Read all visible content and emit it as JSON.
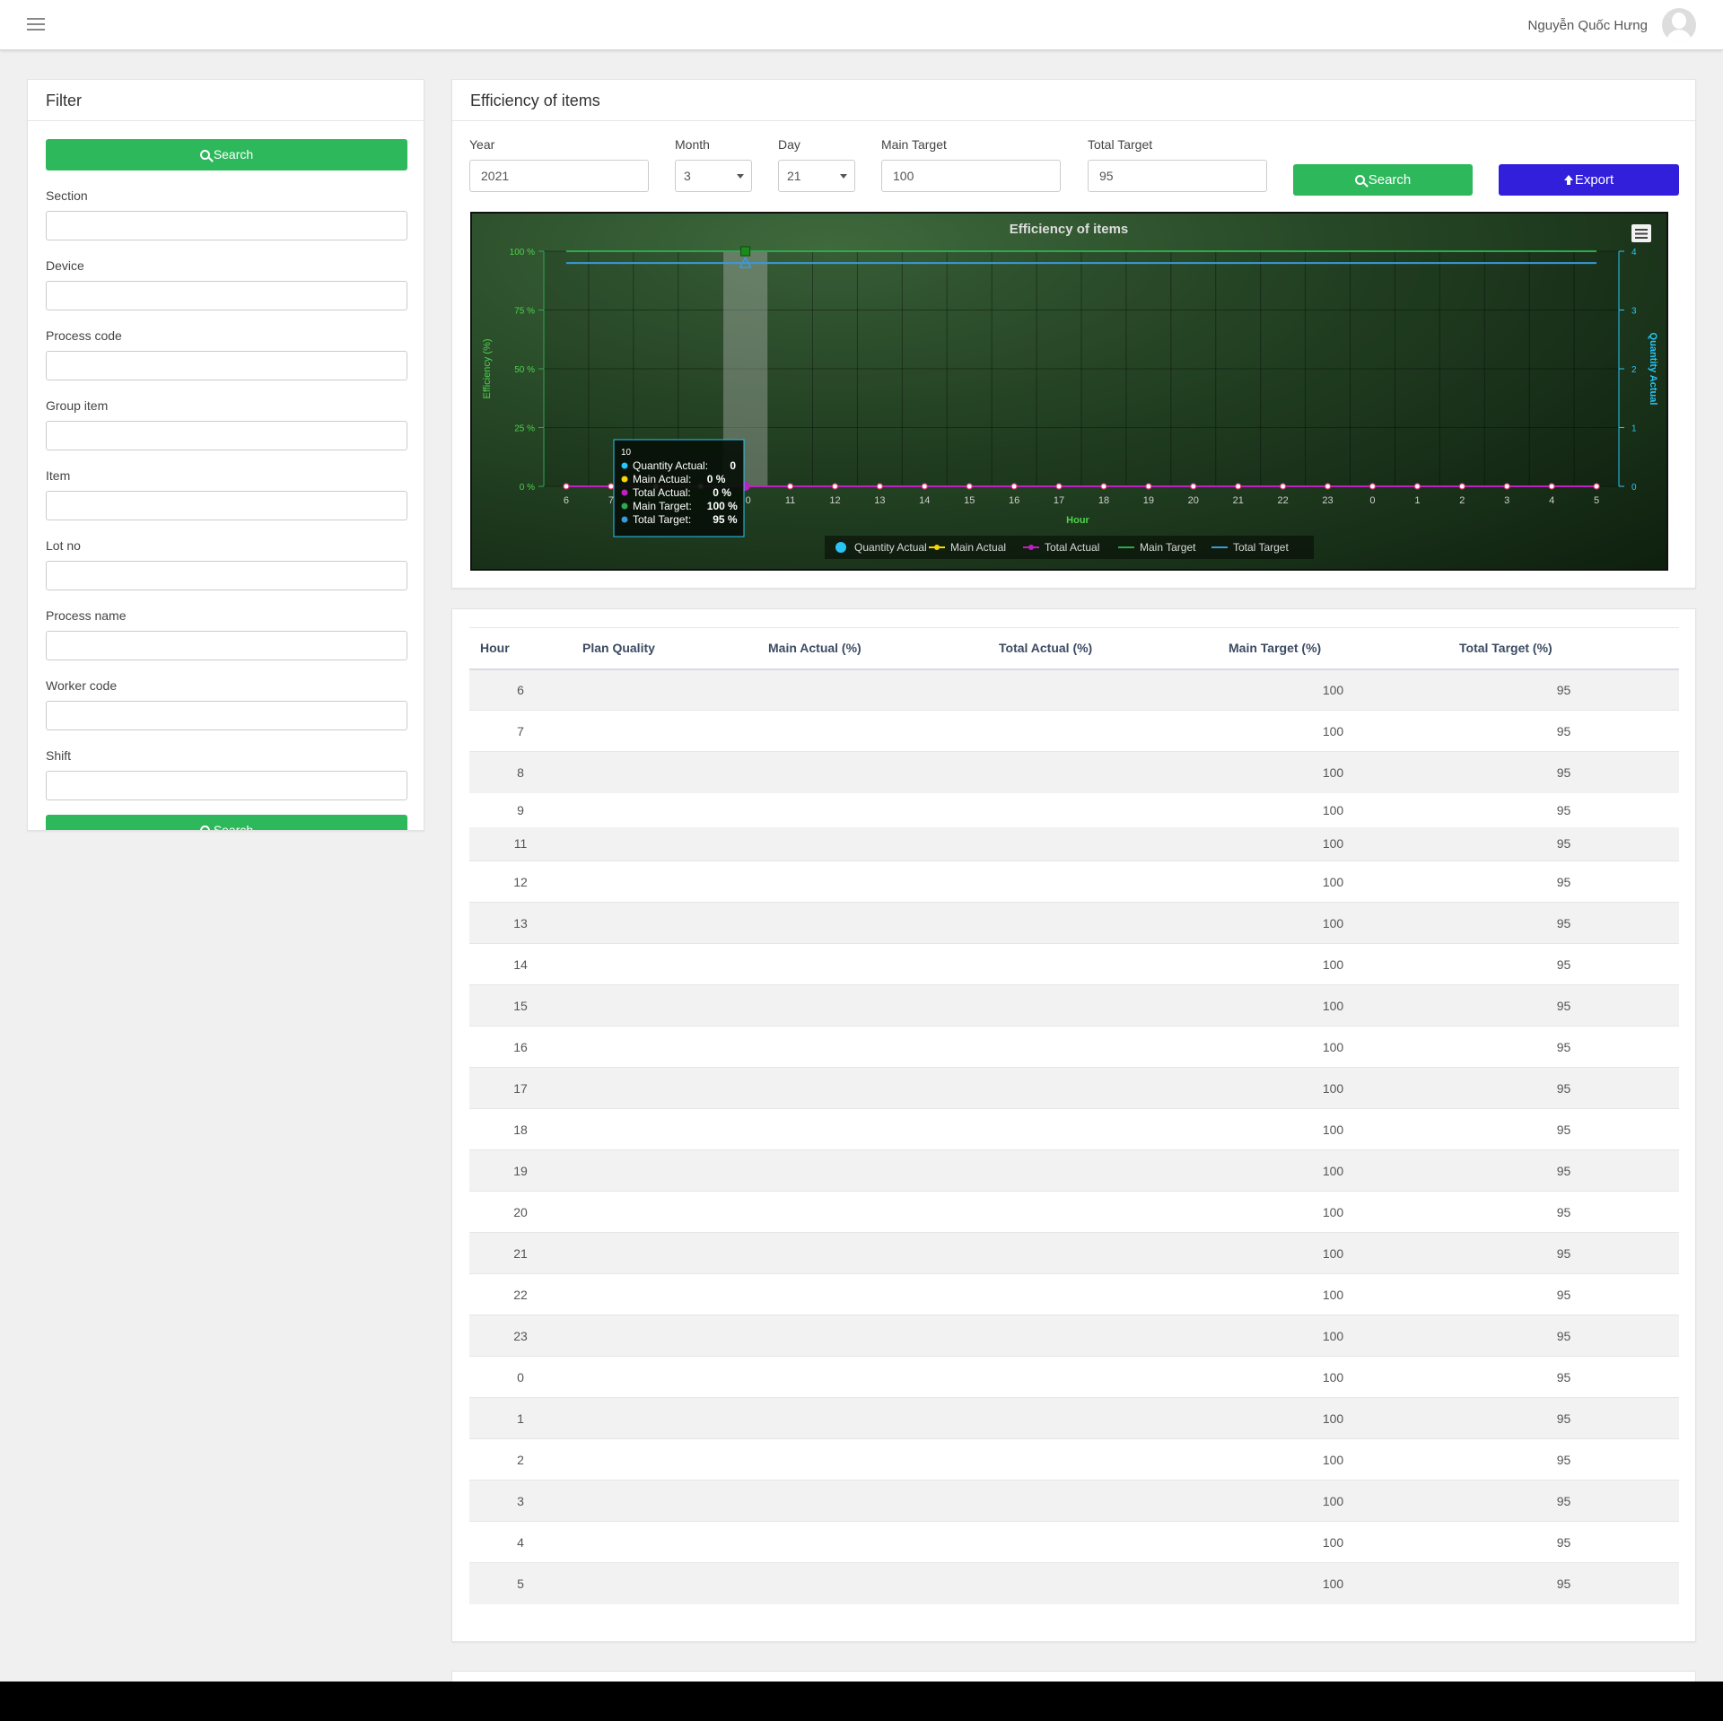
{
  "header": {
    "user_name": "Nguyễn Quốc Hưng"
  },
  "filter": {
    "title": "Filter",
    "search_label": "Search",
    "fields": [
      "Section",
      "Device",
      "Process code",
      "Group item",
      "Item",
      "Lot no",
      "Process name",
      "Worker code",
      "Shift"
    ]
  },
  "main": {
    "title": "Efficiency of items",
    "form": {
      "year_label": "Year",
      "year_value": "2021",
      "month_label": "Month",
      "month_value": "3",
      "day_label": "Day",
      "day_value": "21",
      "main_target_label": "Main Target",
      "main_target_value": "100",
      "total_target_label": "Total Target",
      "total_target_value": "95",
      "search_label": "Search",
      "export_label": "Export"
    }
  },
  "colors": {
    "quantity_actual": "#29c5f6",
    "main_actual": "#f5d800",
    "total_actual": "#c020c0",
    "main_target": "#2fa84f",
    "total_target": "#3b9ad9",
    "green_button": "#2eb85c",
    "export_button": "#321fdb"
  },
  "chart_data": {
    "type": "line",
    "title": "Efficiency of items",
    "xlabel": "Hour",
    "ylabel": "Efficiency (%)",
    "y2label": "Quantity Actual",
    "categories": [
      "6",
      "7",
      "8",
      "9",
      "10",
      "11",
      "12",
      "13",
      "14",
      "15",
      "16",
      "17",
      "18",
      "19",
      "20",
      "21",
      "22",
      "23",
      "0",
      "1",
      "2",
      "3",
      "4",
      "5"
    ],
    "x_tick_labels": [
      "6",
      "7",
      "",
      "",
      "0",
      "11",
      "12",
      "13",
      "14",
      "15",
      "16",
      "17",
      "18",
      "19",
      "20",
      "21",
      "22",
      "23",
      "0",
      "1",
      "2",
      "3",
      "4",
      "5"
    ],
    "ylim": [
      0,
      100
    ],
    "y_ticks": [
      "0 %",
      "25 %",
      "50 %",
      "75 %",
      "100 %"
    ],
    "y2lim": [
      0,
      4
    ],
    "y2_ticks": [
      "0",
      "1",
      "2",
      "3",
      "4"
    ],
    "series": [
      {
        "name": "Quantity Actual",
        "axis": "y2",
        "values": [
          0,
          0,
          0,
          0,
          0,
          0,
          0,
          0,
          0,
          0,
          0,
          0,
          0,
          0,
          0,
          0,
          0,
          0,
          0,
          0,
          0,
          0,
          0,
          0
        ]
      },
      {
        "name": "Main Actual",
        "values": [
          0,
          0,
          0,
          0,
          0,
          0,
          0,
          0,
          0,
          0,
          0,
          0,
          0,
          0,
          0,
          0,
          0,
          0,
          0,
          0,
          0,
          0,
          0,
          0
        ]
      },
      {
        "name": "Total Actual",
        "values": [
          0,
          0,
          0,
          0,
          0,
          0,
          0,
          0,
          0,
          0,
          0,
          0,
          0,
          0,
          0,
          0,
          0,
          0,
          0,
          0,
          0,
          0,
          0,
          0
        ]
      },
      {
        "name": "Main Target",
        "values": [
          100,
          100,
          100,
          100,
          100,
          100,
          100,
          100,
          100,
          100,
          100,
          100,
          100,
          100,
          100,
          100,
          100,
          100,
          100,
          100,
          100,
          100,
          100,
          100
        ]
      },
      {
        "name": "Total Target",
        "values": [
          95,
          95,
          95,
          95,
          95,
          95,
          95,
          95,
          95,
          95,
          95,
          95,
          95,
          95,
          95,
          95,
          95,
          95,
          95,
          95,
          95,
          95,
          95,
          95
        ]
      }
    ],
    "highlight_index": 4,
    "tooltip": {
      "title": "10",
      "rows": [
        {
          "label": "Quantity Actual:",
          "value": "0"
        },
        {
          "label": "Main Actual:",
          "value": "0 %"
        },
        {
          "label": "Total Actual:",
          "value": "0 %"
        },
        {
          "label": "Main Target:",
          "value": "100 %"
        },
        {
          "label": "Total Target:",
          "value": "95 %"
        }
      ]
    },
    "legend": [
      "Quantity Actual",
      "Main Actual",
      "Total Actual",
      "Main Target",
      "Total Target"
    ]
  },
  "table": {
    "columns": [
      "Hour",
      "Plan Quality",
      "Main Actual (%)",
      "Total Actual (%)",
      "Main Target (%)",
      "Total Target (%)"
    ],
    "rows": [
      [
        "6",
        "",
        "",
        "",
        "100",
        "95"
      ],
      [
        "7",
        "",
        "",
        "",
        "100",
        "95"
      ],
      [
        "8",
        "",
        "",
        "",
        "100",
        "95"
      ],
      [
        "9",
        "",
        "",
        "",
        "100",
        "95"
      ],
      [
        "11",
        "",
        "",
        "",
        "100",
        "95"
      ],
      [
        "12",
        "",
        "",
        "",
        "100",
        "95"
      ],
      [
        "13",
        "",
        "",
        "",
        "100",
        "95"
      ],
      [
        "14",
        "",
        "",
        "",
        "100",
        "95"
      ],
      [
        "15",
        "",
        "",
        "",
        "100",
        "95"
      ],
      [
        "16",
        "",
        "",
        "",
        "100",
        "95"
      ],
      [
        "17",
        "",
        "",
        "",
        "100",
        "95"
      ],
      [
        "18",
        "",
        "",
        "",
        "100",
        "95"
      ],
      [
        "19",
        "",
        "",
        "",
        "100",
        "95"
      ],
      [
        "20",
        "",
        "",
        "",
        "100",
        "95"
      ],
      [
        "21",
        "",
        "",
        "",
        "100",
        "95"
      ],
      [
        "22",
        "",
        "",
        "",
        "100",
        "95"
      ],
      [
        "23",
        "",
        "",
        "",
        "100",
        "95"
      ],
      [
        "0",
        "",
        "",
        "",
        "100",
        "95"
      ],
      [
        "1",
        "",
        "",
        "",
        "100",
        "95"
      ],
      [
        "2",
        "",
        "",
        "",
        "100",
        "95"
      ],
      [
        "3",
        "",
        "",
        "",
        "100",
        "95"
      ],
      [
        "4",
        "",
        "",
        "",
        "100",
        "95"
      ],
      [
        "5",
        "",
        "",
        "",
        "100",
        "95"
      ]
    ]
  }
}
